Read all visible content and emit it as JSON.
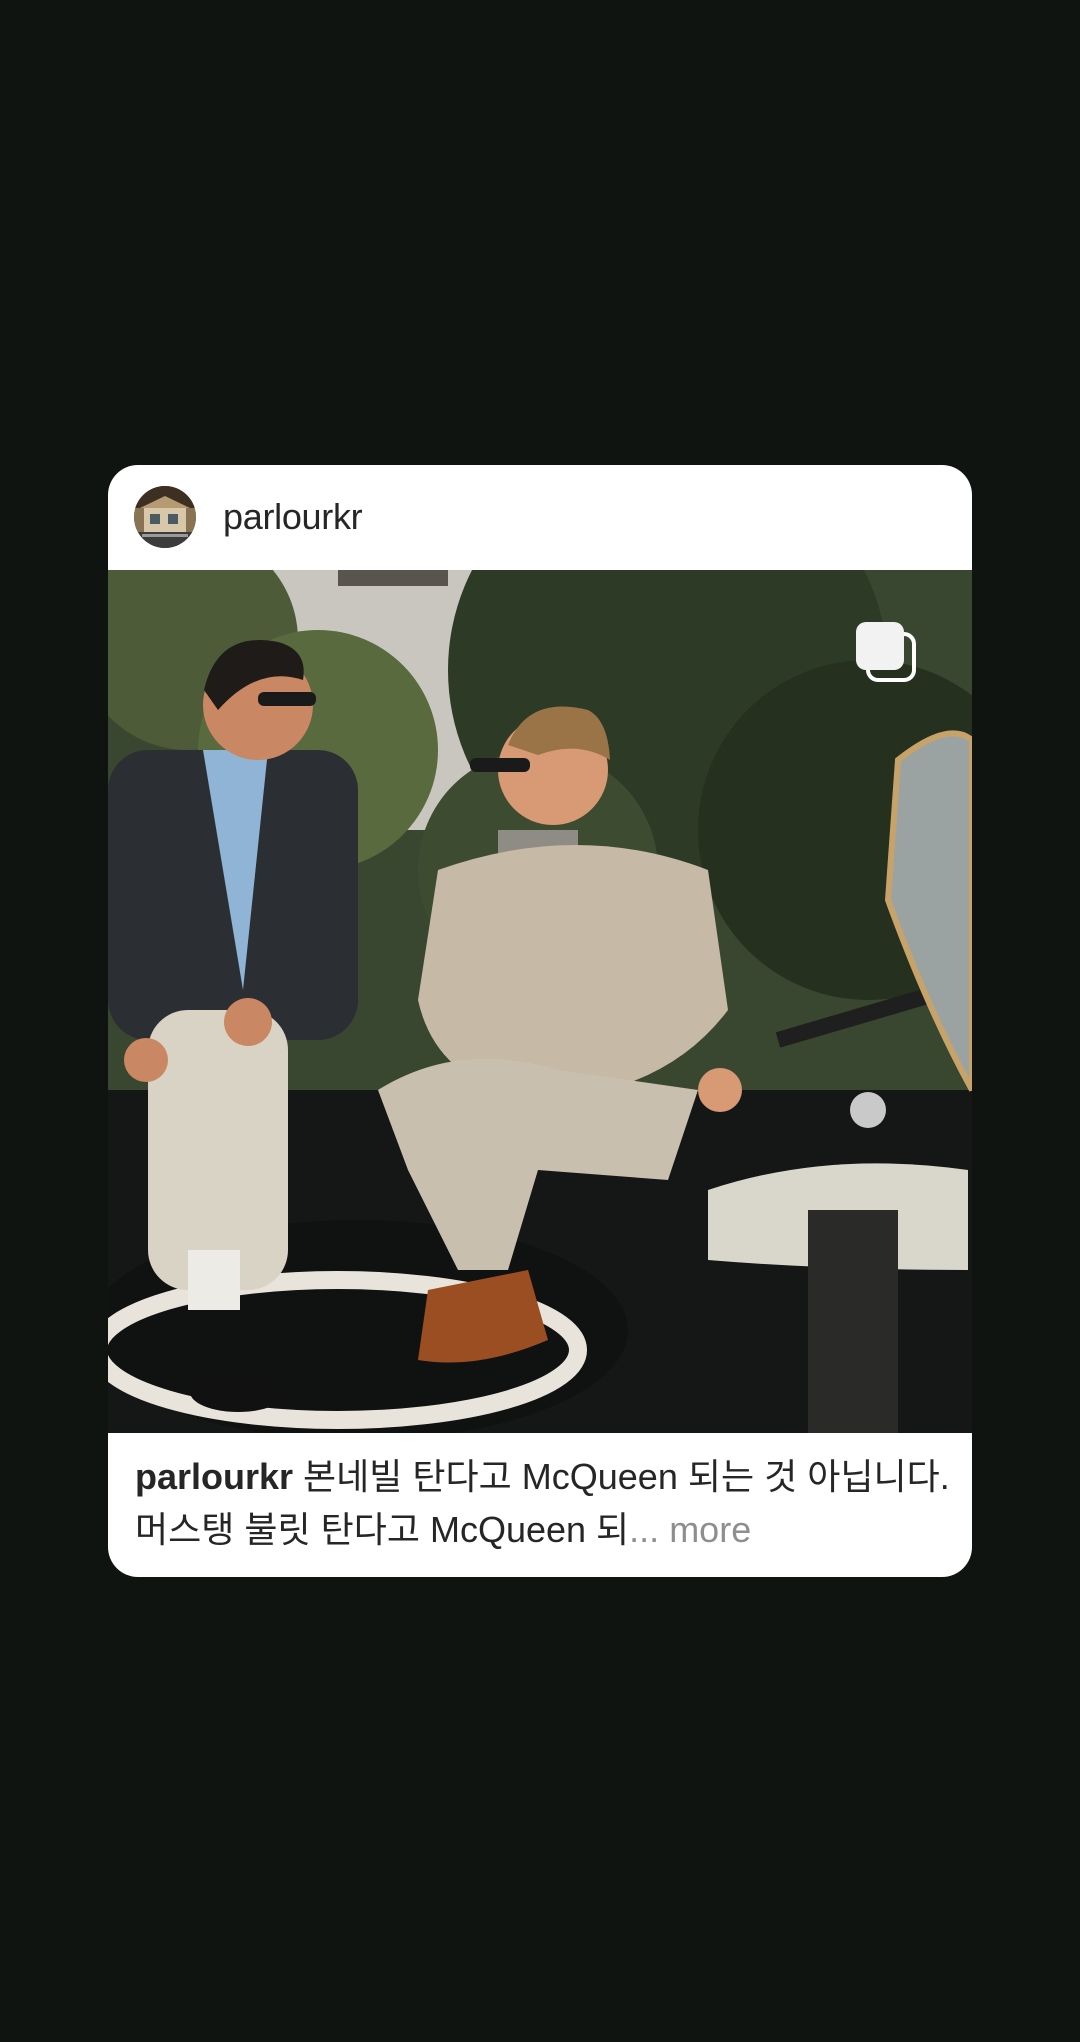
{
  "post": {
    "username": "parlourkr",
    "avatar_icon": "profile-avatar-icon",
    "multi_image_icon": "carousel-icon",
    "caption": {
      "username": "parlourkr",
      "text": " 본네빌 탄다고 McQueen 되는 것 아닙니다. 머스탱 불릿 탄다고 McQueen 되",
      "ellipsis": "...",
      "more_label": " more"
    }
  },
  "colors": {
    "background": "#0f1410",
    "card": "#ffffff",
    "text": "#262626",
    "muted": "#8e8e8e"
  }
}
